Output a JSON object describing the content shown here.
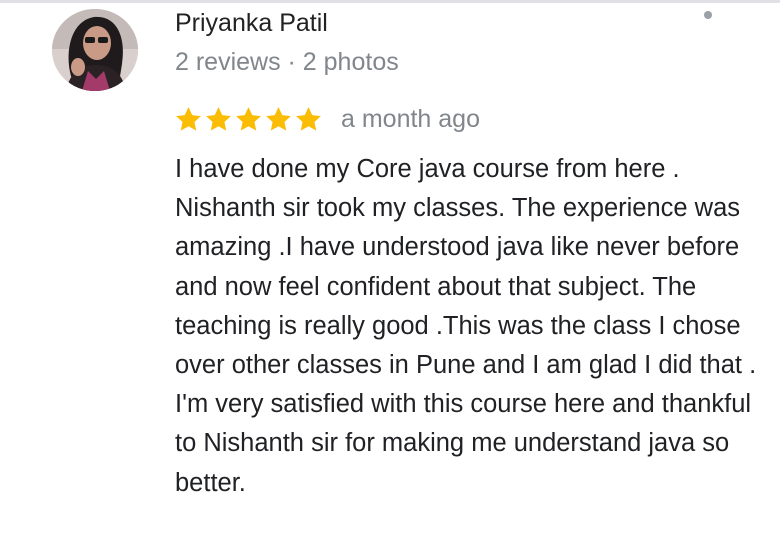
{
  "reviewer": {
    "name": "Priyanka Patil",
    "meta": "2 reviews · 2 photos"
  },
  "rating": {
    "stars": 5,
    "max": 5,
    "star_color": "#fbbc04",
    "time": "a month ago"
  },
  "review": {
    "text": "I have done my Core java course from here . Nishanth sir took my classes. The experience was amazing .I have understood java like never before and now feel confident about that subject. The teaching is really good .This was the class I chose over other classes in Pune and I am glad I did that . I'm very satisfied with this course here and thankful to Nishanth sir for making me understand java so better."
  },
  "icons": {
    "avatar": "profile-photo",
    "star": "star-icon",
    "more": "more-options-icon"
  }
}
